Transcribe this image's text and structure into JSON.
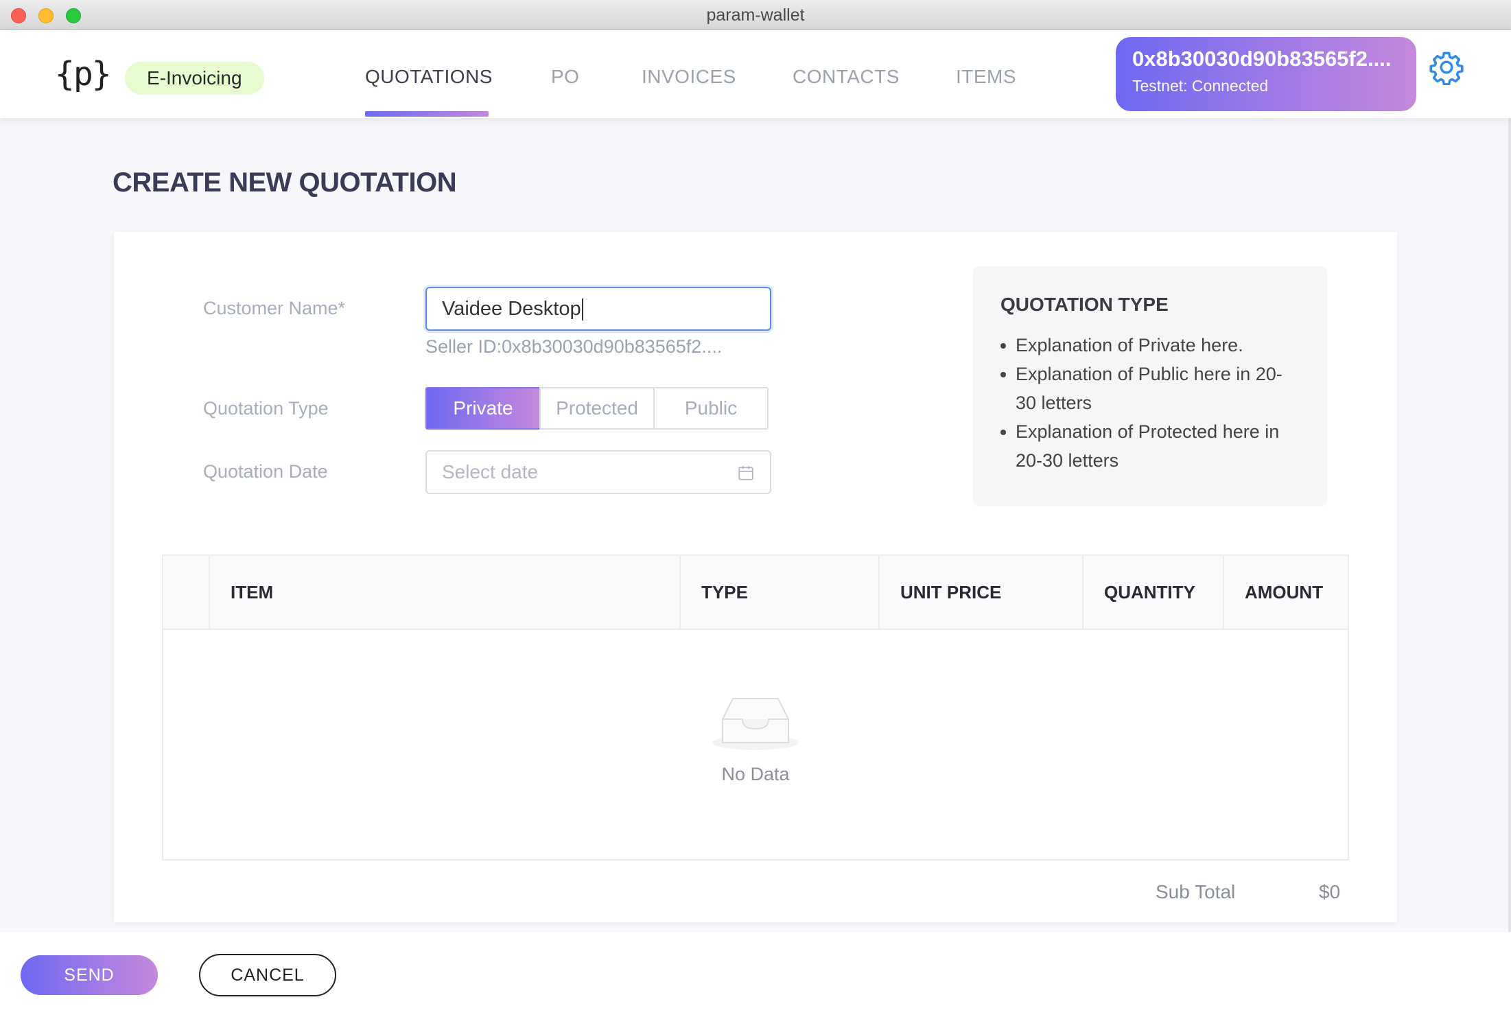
{
  "window": {
    "title": "param-wallet"
  },
  "header": {
    "logo": "{p}",
    "badge": "E-Invoicing",
    "nav": [
      {
        "label": "QUOTATIONS",
        "active": true
      },
      {
        "label": "PO",
        "active": false
      },
      {
        "label": "INVOICES",
        "active": false
      },
      {
        "label": "CONTACTS",
        "active": false
      },
      {
        "label": "ITEMS",
        "active": false
      }
    ],
    "wallet": {
      "address": "0x8b30030d90b83565f2....",
      "status": "Testnet: Connected"
    },
    "settings_icon": "gear-icon"
  },
  "page": {
    "title": "CREATE NEW QUOTATION"
  },
  "form": {
    "customer_label": "Customer Name*",
    "customer_value": "Vaidee Desktop",
    "seller_id": "Seller ID:0x8b30030d90b83565f2....",
    "type_label": "Quotation Type",
    "type_options": [
      "Private",
      "Protected",
      "Public"
    ],
    "type_selected": "Private",
    "date_label": "Quotation Date",
    "date_placeholder": "Select date",
    "date_icon": "calendar-icon"
  },
  "info": {
    "title": "QUOTATION TYPE",
    "items": [
      "Explanation of Private here.",
      "Explanation of Public here in 20-30 letters",
      "Explanation of Protected here in 20-30 letters"
    ]
  },
  "table": {
    "columns": [
      "ITEM",
      "TYPE",
      "UNIT PRICE",
      "QUANTITY",
      "AMOUNT"
    ],
    "rows": [],
    "empty_text": "No Data",
    "empty_icon": "inbox-icon"
  },
  "summary": {
    "subtotal_label": "Sub Total",
    "subtotal_value": "$0"
  },
  "footer": {
    "send_label": "SEND",
    "cancel_label": "CANCEL"
  },
  "colors": {
    "accent_start": "#6e68f2",
    "accent_end": "#c688dc",
    "badge_bg": "#e6fbd0",
    "focus": "#5a8de8"
  }
}
